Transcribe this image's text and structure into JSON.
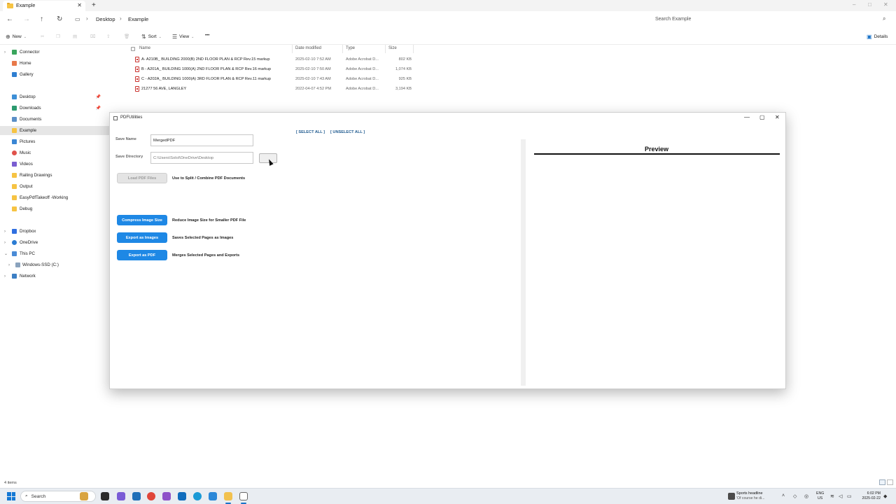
{
  "explorer": {
    "tab_title": "Example",
    "new_tab": "+",
    "tab_close": "✕",
    "window_controls": {
      "minimize": "–",
      "maximize": "□",
      "close": "✕"
    },
    "breadcrumb": [
      "Desktop",
      "Example"
    ],
    "search_placeholder": "Search Example",
    "commands": {
      "new": "New",
      "sort": "Sort",
      "view": "View",
      "more": "•••",
      "details": "Details"
    },
    "columns": {
      "name": "Name",
      "date": "Date modified",
      "type": "Type",
      "size": "Size"
    },
    "files": [
      {
        "name": "A- A210B_ BUILDING 2000(B) 2ND FLOOR PLAN & RCP Rev.15 markup",
        "date": "2025-02-10 7:52 AM",
        "type": "Adobe Acrobat D...",
        "size": "802 KB"
      },
      {
        "name": "B - A201A_ BUILDING 1000(A) 2ND FLOOR PLAN & RCP Rev.16 markup",
        "date": "2025-02-10 7:50 AM",
        "type": "Adobe Acrobat D...",
        "size": "1,074 KB"
      },
      {
        "name": "C - A202A_ BUILDING 1000(A) 3RD FLOOR PLAN & RCP Rev.11 markup",
        "date": "2025-02-10 7:43 AM",
        "type": "Adobe Acrobat D...",
        "size": "925 KB"
      },
      {
        "name": "21277 56 AVE, LANGLEY",
        "date": "2022-04-07 4:52 PM",
        "type": "Adobe Acrobat D...",
        "size": "3,194 KB"
      }
    ],
    "status": "4 items",
    "sidebar": {
      "connector": "Connector",
      "home": "Home",
      "gallery": "Gallery",
      "desktop": "Desktop",
      "downloads": "Downloads",
      "documents": "Documents",
      "example": "Example",
      "pictures": "Pictures",
      "music": "Music",
      "videos": "Videos",
      "railing": "Railing Drawings",
      "output": "Output",
      "easypdf": "EasyPdfTakeoff -Working",
      "debug": "Debug",
      "dropbox": "Dropbox",
      "onedrive": "OneDrive",
      "thispc": "This PC",
      "windows_ssd": "Windows-SSD (C:)",
      "network": "Network"
    }
  },
  "pdfutil": {
    "title": "PDFUtilities",
    "controls": {
      "minimize": "—",
      "maximize": "▢",
      "close": "✕"
    },
    "save_name_label": "Save Name",
    "save_name_value": "MergedPDF",
    "save_dir_label": "Save Directory",
    "save_dir_value": "C:\\Users\\Solol\\OneDrive\\Desktop",
    "load_button": "Load PDF Files",
    "load_desc": "Use to Split / Combine PDF Documents",
    "compress_button": "Compress Image Size",
    "compress_desc": "Reduce Image Size for Smaller PDF File",
    "export_images_button": "Export as Images",
    "export_images_desc": "Saves Selected Pages as Images",
    "export_pdf_button": "Export as PDF",
    "export_pdf_desc": "Merges Selected Pages and Exports",
    "select_all": "[ SELECT ALL ]",
    "unselect_all": "[ UNSELECT ALL ]",
    "preview_title": "Preview"
  },
  "taskbar": {
    "search": "Search",
    "news_headline": "Sports headline",
    "news_sub": "'Of course he di...",
    "lang_line1": "ENG",
    "lang_line2": "US",
    "time": "6:02 PM",
    "date": "2025-02-22"
  },
  "colors": {
    "accent_blue": "#1e88e5",
    "folder_yellow": "#f6c343",
    "pdf_red": "#c9302c",
    "link_blue": "#1f5a8f"
  }
}
